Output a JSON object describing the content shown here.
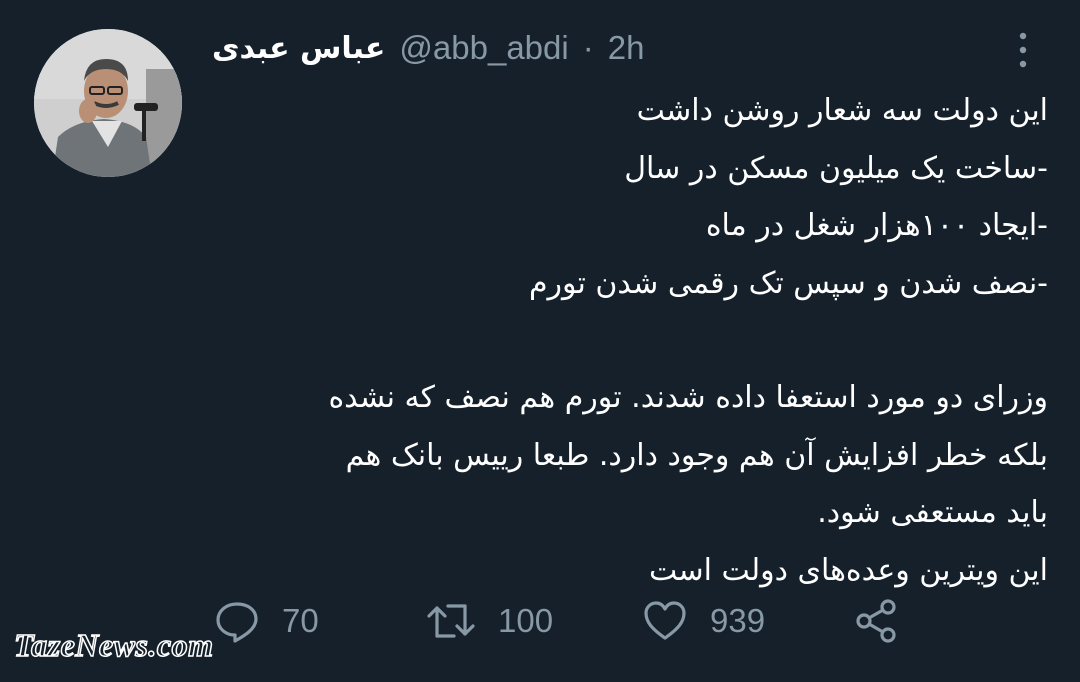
{
  "tweet": {
    "author": {
      "display_name": "عباس عبدی",
      "handle": "@abb_abdi"
    },
    "separator": "·",
    "time": "2h",
    "body_lines": [
      "این دولت سه شعار روشن داشت",
      "-ساخت یک میلیون مسکن در سال",
      "-ایجاد ۱۰۰هزار شغل در ماه",
      "-نصف شدن و سپس تک رقمی شدن تورم",
      "",
      "وزرای دو مورد استعفا داده شدند. تورم هم نصف که نشده",
      "بلکه خطر افزایش آن هم وجود دارد. طبعا رییس بانک هم",
      "باید مستعفی شود.",
      "این ویترین وعده‌های دولت است"
    ],
    "actions": {
      "reply_count": "70",
      "retweet_count": "100",
      "like_count": "939"
    }
  },
  "icons": {
    "more": "more-vertical-icon",
    "reply": "reply-icon",
    "retweet": "retweet-icon",
    "like": "heart-icon",
    "share": "share-icon"
  },
  "colors": {
    "background": "#15202b",
    "text": "#ffffff",
    "secondary": "#8899a6"
  },
  "watermark": "TazeNews.com"
}
